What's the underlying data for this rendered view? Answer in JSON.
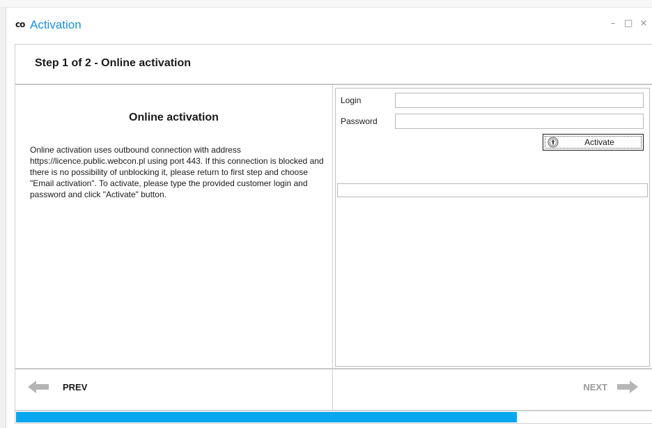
{
  "window": {
    "logo": "co",
    "title": "Activation",
    "controls": {
      "minimize": "–",
      "maximize": "□",
      "close": "×"
    }
  },
  "step": {
    "title": "Step 1 of 2 - Online activation"
  },
  "left_panel": {
    "heading": "Online activation",
    "description": "Online activation uses outbound connection with address https://licence.public.webcon.pl using port 443. If this connection is blocked and there is no possibility of unblocking it, please return to first step and choose \"Email activation\". To activate, please type the provided customer login and password and click \"Activate\" button."
  },
  "form": {
    "login_label": "Login",
    "login_value": "",
    "password_label": "Password",
    "password_value": "",
    "activate_label": "Activate",
    "status_text": ""
  },
  "nav": {
    "prev_label": "PREV",
    "next_label": "NEXT"
  },
  "progress": {
    "percent": 78.8
  },
  "colors": {
    "accent": "#1a8fd6",
    "progress": "#0aa6ef",
    "arrow_disabled": "#b5b5b5",
    "text": "#1a1a1a"
  },
  "icons": {
    "prev": "arrow-left-icon",
    "next": "arrow-right-icon",
    "activate": "upload-circle-icon"
  }
}
